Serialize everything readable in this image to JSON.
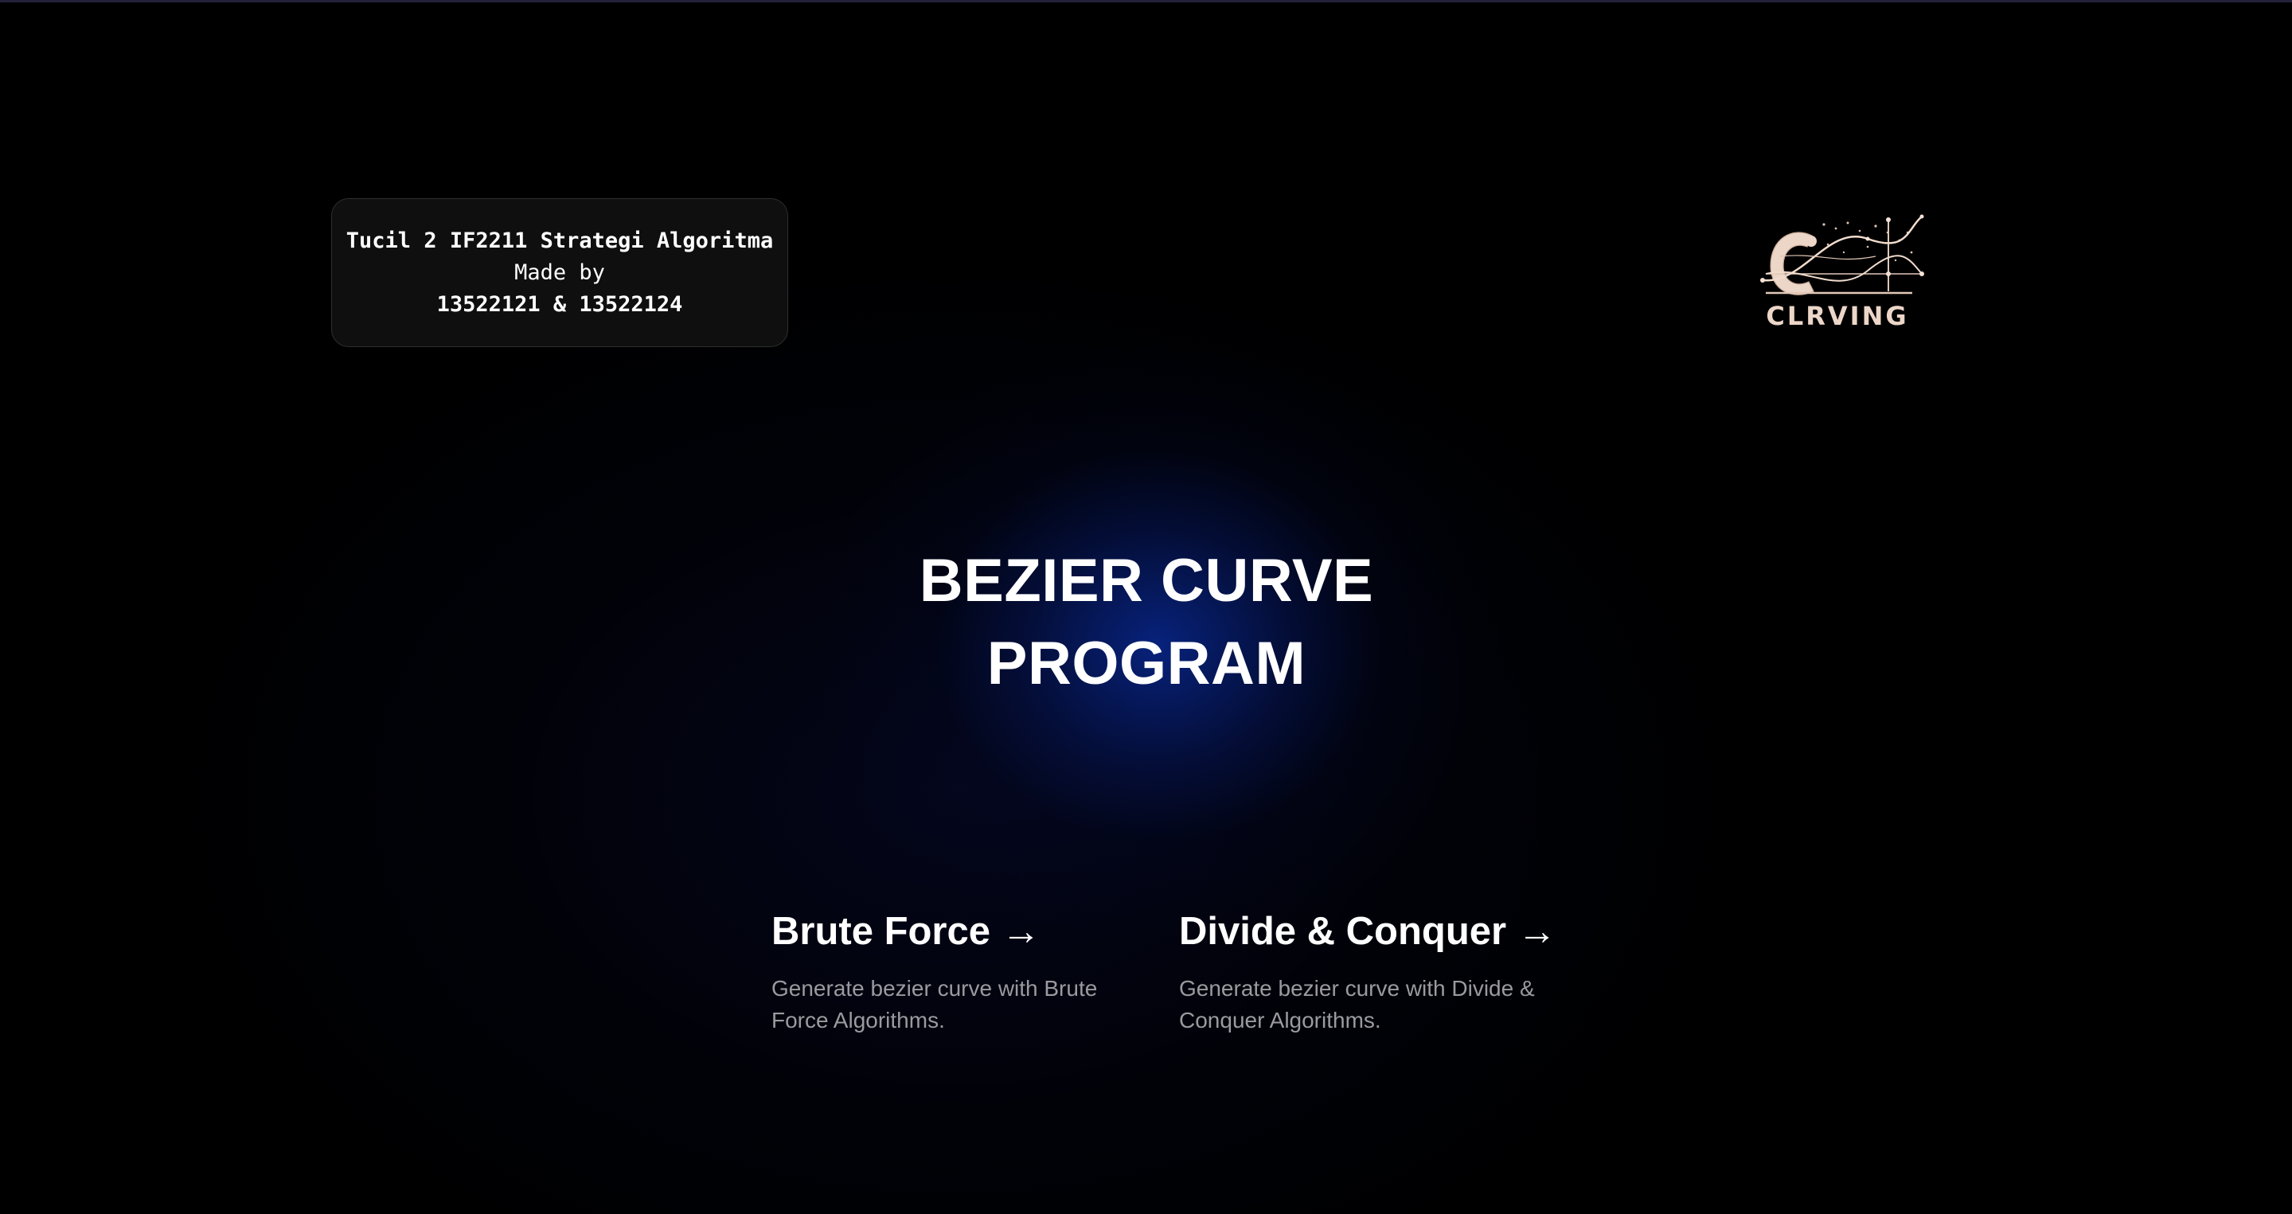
{
  "info_card": {
    "line1": "Tucil 2 IF2211 Strategi Algoritma",
    "line2": "Made by",
    "line3": "13522121 & 13522124"
  },
  "logo": {
    "text": "CLRVING",
    "icon": "curving-logo"
  },
  "hero": {
    "title_line1": "BEZIER CURVE",
    "title_line2": "PROGRAM"
  },
  "cards": [
    {
      "title": "Brute Force",
      "arrow": "→",
      "description": "Generate bezier curve with Brute Force Algorithms."
    },
    {
      "title": "Divide & Conquer",
      "arrow": "→",
      "description": "Generate bezier curve with Divide & Conquer Algorithms."
    }
  ],
  "colors": {
    "background": "#000000",
    "glow": "#08247f",
    "card_bg": "#0f0f0f",
    "muted_text": "#9a9a9f",
    "logo_tan": "#e8cdbd"
  }
}
